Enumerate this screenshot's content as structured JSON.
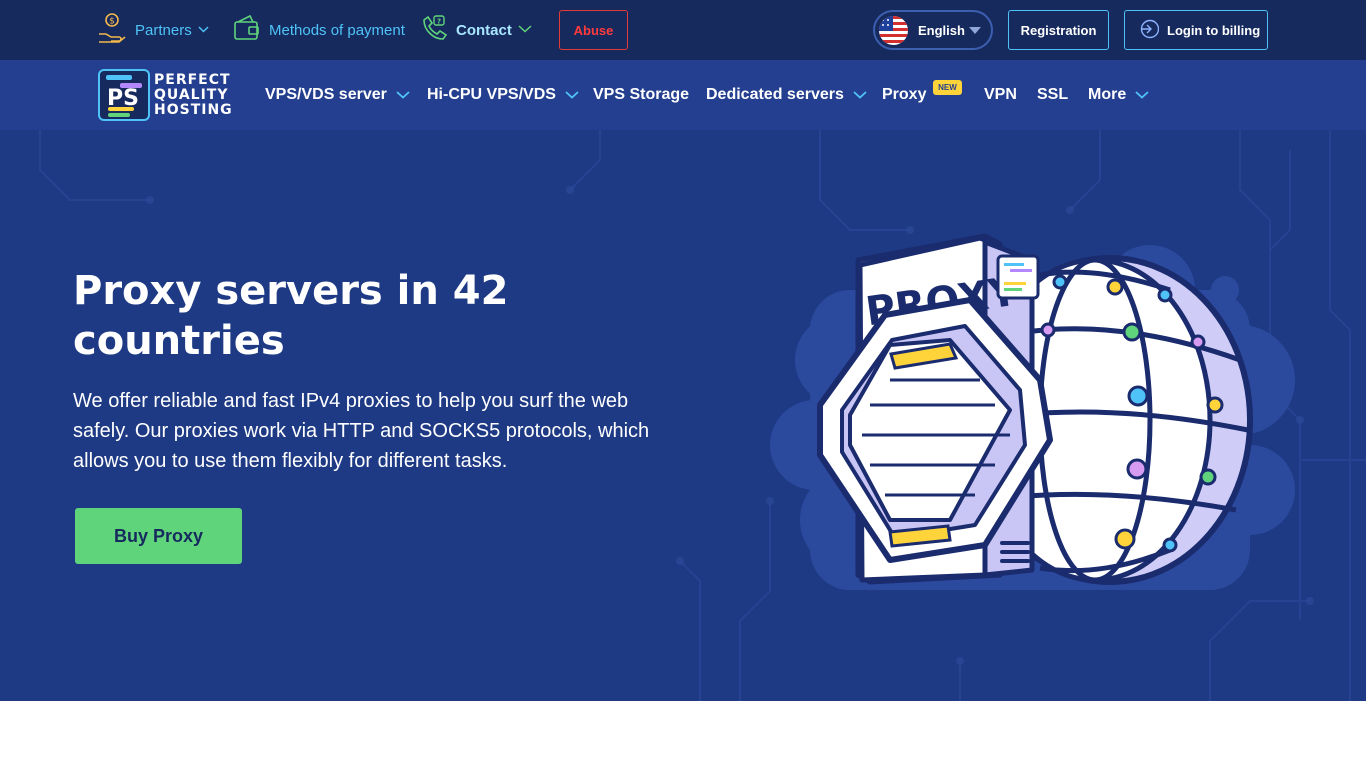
{
  "topbar": {
    "partners_label": "Partners",
    "payment_label": "Methods of payment",
    "contact_label": "Contact",
    "abuse_label": "Abuse",
    "language_label": "English",
    "registration_label": "Registration",
    "login_label": "Login to billing"
  },
  "logo": {
    "line1": "PERFECT",
    "line2": "QUALITY",
    "line3": "HOSTING"
  },
  "nav": {
    "items": [
      {
        "label": "VPS/VDS server"
      },
      {
        "label": "Hi-CPU VPS/VDS"
      },
      {
        "label": "VPS Storage"
      },
      {
        "label": "Dedicated servers"
      },
      {
        "label": "Proxy"
      },
      {
        "label": "VPN"
      },
      {
        "label": "SSL"
      },
      {
        "label": "More"
      }
    ],
    "new_badge": "NEW"
  },
  "hero": {
    "title": "Proxy servers in 42 countries",
    "description": "We offer reliable and fast IPv4 proxies to help you surf the web safely. Our proxies work via HTTP and SOCKS5 protocols, which allows you to use them flexibly for different tasks.",
    "buy_label": "Buy Proxy",
    "illustration_text": "PROXY"
  },
  "colors": {
    "topbar_bg": "#162a5e",
    "navbar_bg": "#243f8f",
    "hero_bg": "#1e3a85",
    "accent_cyan": "#4fc3f7",
    "buy_green": "#5fd47a",
    "abuse_red": "#e53935",
    "badge_yellow": "#ffd43b"
  },
  "icons": {
    "partners": "money-hand-icon",
    "payment": "wallet-icon",
    "contact": "phone-icon",
    "language": "us-flag-icon",
    "login": "login-arrow-icon"
  }
}
